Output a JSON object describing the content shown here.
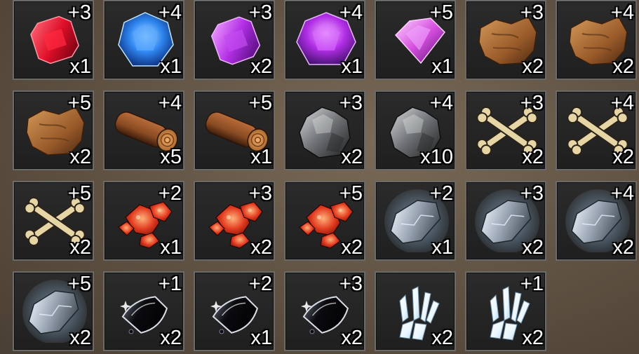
{
  "inventory": [
    {
      "icon": "red-gem-icon",
      "level": "+3",
      "qty": "x1"
    },
    {
      "icon": "blue-gem-icon",
      "level": "+4",
      "qty": "x1"
    },
    {
      "icon": "purple-emerald-gem-icon",
      "level": "+3",
      "qty": "x2"
    },
    {
      "icon": "purple-round-gem-icon",
      "level": "+4",
      "qty": "x1"
    },
    {
      "icon": "pink-gem-icon",
      "level": "+5",
      "qty": "x1"
    },
    {
      "icon": "leather-hide-icon",
      "level": "+3",
      "qty": "x2"
    },
    {
      "icon": "leather-hide-icon",
      "level": "+4",
      "qty": "x2"
    },
    {
      "icon": "leather-hide-icon",
      "level": "+5",
      "qty": "x2"
    },
    {
      "icon": "wood-log-icon",
      "level": "+4",
      "qty": "x5"
    },
    {
      "icon": "wood-log-icon",
      "level": "+5",
      "qty": "x1"
    },
    {
      "icon": "stone-ore-icon",
      "level": "+3",
      "qty": "x2"
    },
    {
      "icon": "stone-ore-icon",
      "level": "+4",
      "qty": "x10"
    },
    {
      "icon": "crossed-bones-icon",
      "level": "+3",
      "qty": "x2"
    },
    {
      "icon": "crossed-bones-icon",
      "level": "+4",
      "qty": "x2"
    },
    {
      "icon": "crossed-bones-icon",
      "level": "+5",
      "qty": "x2"
    },
    {
      "icon": "red-ore-icon",
      "level": "+2",
      "qty": "x1"
    },
    {
      "icon": "red-ore-icon",
      "level": "+3",
      "qty": "x2"
    },
    {
      "icon": "red-ore-icon",
      "level": "+5",
      "qty": "x2"
    },
    {
      "icon": "silver-ore-icon",
      "level": "+2",
      "qty": "x1"
    },
    {
      "icon": "silver-ore-icon",
      "level": "+3",
      "qty": "x2"
    },
    {
      "icon": "silver-ore-icon",
      "level": "+4",
      "qty": "x2"
    },
    {
      "icon": "silver-ore-icon",
      "level": "+5",
      "qty": "x2"
    },
    {
      "icon": "black-crystal-icon",
      "level": "+1",
      "qty": "x2"
    },
    {
      "icon": "black-crystal-icon",
      "level": "+2",
      "qty": "x1"
    },
    {
      "icon": "black-crystal-icon",
      "level": "+3",
      "qty": "x2"
    },
    {
      "icon": "ice-shard-icon",
      "level": "",
      "qty": "x2"
    },
    {
      "icon": "ice-shard-icon",
      "level": "+1",
      "qty": "x2"
    }
  ],
  "colors": {
    "red_gem": "#e0102a",
    "blue_gem": "#2f86f0",
    "purple_gem": "#b22ee6",
    "pink_gem": "#d64fe0",
    "leather": "#9a5b2a",
    "wood": "#8a4b22",
    "stone": "#6f7275",
    "bone": "#e6d6a6",
    "red_ore": "#e23a1f",
    "silver_ore": "#9aa6b3",
    "black_crystal": "#0b0b10",
    "ice": "#e9f6ff"
  }
}
